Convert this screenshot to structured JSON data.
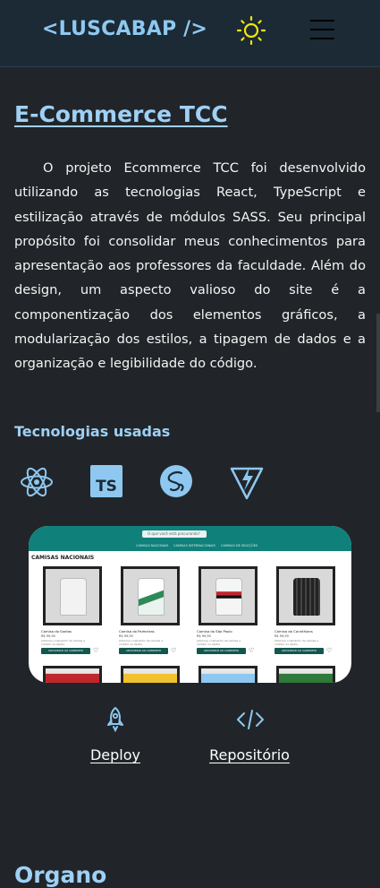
{
  "header": {
    "logo": "<LUSCABAP />",
    "theme_icon": "sun-icon",
    "menu_icon": "hamburger-menu-icon"
  },
  "project": {
    "title": "E-Commerce TCC",
    "description": "O projeto Ecommerce TCC foi desenvolvido utilizando as tecnologias React, TypeScript e estilização através de módulos SASS. Seu principal propósito foi consolidar meus conhecimentos para apresentação aos professores da faculdade. Além do design, um aspecto valioso do site é a componentização dos elementos gráficos, a modularização dos estilos, a tipagem de dados e a organização e legibilidade do código.",
    "tech_title": "Tecnologias usadas",
    "technologies": [
      "react-icon",
      "typescript-icon",
      "sass-icon",
      "vite-icon"
    ],
    "preview": {
      "search_placeholder": "O que você está procurando?",
      "nav": [
        "CAMISAS NACIONAIS",
        "CAMISAS INTERNACIONAIS",
        "CAMISAS DE SELEÇÕES"
      ],
      "section": "CAMISAS NACIONAIS",
      "products": [
        {
          "name": "Camisa do Santos",
          "price": "R$ 99,90",
          "shirt_color": "#f2f2f2",
          "accent": "#d9d9d9"
        },
        {
          "name": "Camisa do Palmeiras",
          "price": "R$ 99,90",
          "shirt_color": "#eaf4ee",
          "accent": "#2f8a5a"
        },
        {
          "name": "Camisa do São Paulo",
          "price": "R$ 99,90",
          "shirt_color": "#f5f5f5",
          "accent": "#c0262d"
        },
        {
          "name": "Camisa do Corinthians",
          "price": "R$ 99,90",
          "shirt_color": "#222222",
          "accent": "#555555"
        }
      ],
      "text": "Adicione o tamanho da camisa e conferir os dados",
      "button": "ADICIONAR AO CARRINHO",
      "row2_colors": [
        "#c0262d",
        "#f2c12e",
        "#8ec8f0",
        "#2f7a3a"
      ]
    },
    "links": [
      {
        "label": "Deploy",
        "icon": "rocket-icon"
      },
      {
        "label": "Repositório",
        "icon": "code-icon"
      }
    ]
  },
  "next_project": {
    "title": "Organo"
  },
  "colors": {
    "background": "#212529",
    "header": "#1b2a35",
    "accent": "#9fd0f5",
    "logo": "#8ec8f0",
    "sun": "#f5e50a"
  }
}
